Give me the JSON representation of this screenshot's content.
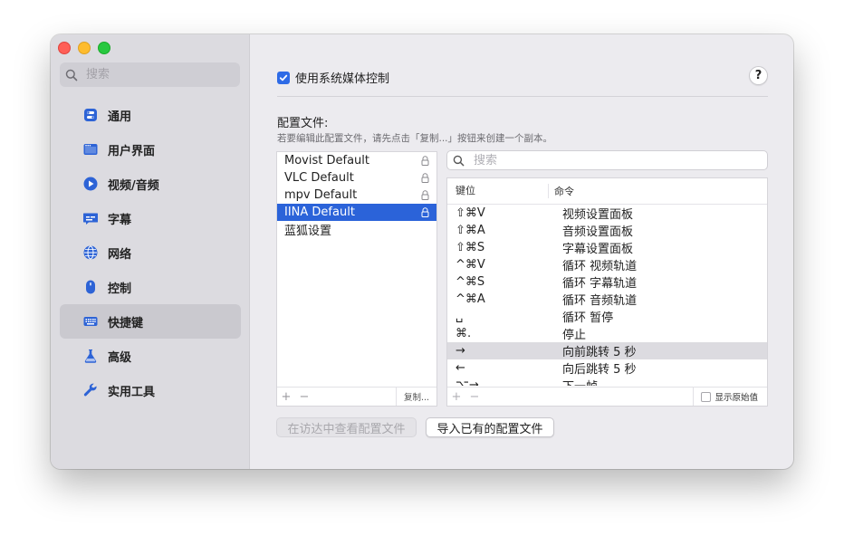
{
  "sidebar": {
    "search_placeholder": "搜索",
    "items": [
      {
        "label": "通用",
        "icon": "toggle-icon",
        "color": "#2d63d6"
      },
      {
        "label": "用户界面",
        "icon": "window-icon",
        "color": "#2d63d6"
      },
      {
        "label": "视频/音频",
        "icon": "play-icon",
        "color": "#2d63d6"
      },
      {
        "label": "字幕",
        "icon": "subtitles-icon",
        "color": "#2d63d6"
      },
      {
        "label": "网络",
        "icon": "globe-icon",
        "color": "#2d63d6"
      },
      {
        "label": "控制",
        "icon": "mouse-icon",
        "color": "#2d63d6"
      },
      {
        "label": "快捷键",
        "icon": "keyboard-icon",
        "color": "#2d63d6",
        "active": true
      },
      {
        "label": "高级",
        "icon": "flask-icon",
        "color": "#2d63d6"
      },
      {
        "label": "实用工具",
        "icon": "wrench-icon",
        "color": "#2d63d6"
      }
    ]
  },
  "main": {
    "media_control_label": "使用系统媒体控制",
    "media_control_checked": true,
    "help_label": "?",
    "profiles_title": "配置文件:",
    "profiles_desc": "若要编辑此配置文件，请先点击「复制...」按钮来创建一个副本。",
    "profiles": [
      {
        "name": "Movist Default",
        "locked": true
      },
      {
        "name": "VLC Default",
        "locked": true
      },
      {
        "name": "mpv Default",
        "locked": true
      },
      {
        "name": "IINA Default",
        "locked": true,
        "selected": true
      },
      {
        "name": "蓝狐设置",
        "locked": false
      }
    ],
    "profile_add": "+",
    "profile_remove": "−",
    "duplicate_label": "复制...",
    "search_placeholder": "搜索",
    "table": {
      "col_key": "键位",
      "col_command": "命令",
      "rows": [
        {
          "key": "⇧⌘V",
          "command": "视频设置面板"
        },
        {
          "key": "⇧⌘A",
          "command": "音频设置面板"
        },
        {
          "key": "⇧⌘S",
          "command": "字幕设置面板"
        },
        {
          "key": "^⌘V",
          "command": "循环 视频轨道"
        },
        {
          "key": "^⌘S",
          "command": "循环 字幕轨道"
        },
        {
          "key": "^⌘A",
          "command": "循环 音频轨道"
        },
        {
          "key": "␣",
          "command": "循环 暂停"
        },
        {
          "key": "⌘.",
          "command": "停止"
        },
        {
          "key": "→",
          "command": "向前跳转 5 秒",
          "highlighted": true
        },
        {
          "key": "←",
          "command": "向后跳转 5 秒"
        },
        {
          "key": "⌥→",
          "command": "下一帧"
        }
      ],
      "add": "+",
      "remove": "−",
      "show_raw_label": "显示原始值",
      "show_raw_checked": false
    },
    "reveal_in_finder_label": "在访达中查看配置文件",
    "import_label": "导入已有的配置文件"
  }
}
